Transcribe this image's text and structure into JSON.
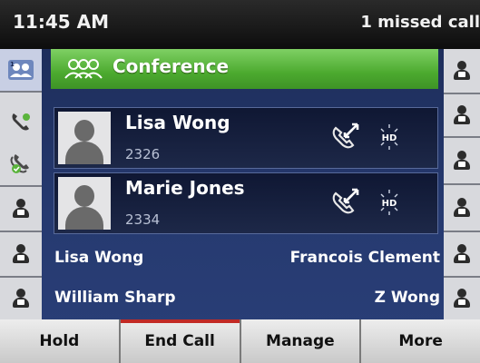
{
  "status": {
    "time": "11:45 AM",
    "missed_calls": "1 missed call"
  },
  "conference": {
    "title": "Conference"
  },
  "calls": [
    {
      "name": "Lisa Wong",
      "number": "2326",
      "hd_label": "HD"
    },
    {
      "name": "Marie Jones",
      "number": "2334",
      "hd_label": "HD"
    }
  ],
  "favorites": [
    {
      "left": "Lisa Wong",
      "right": "Francois Clement"
    },
    {
      "left": "William Sharp",
      "right": "Z Wong"
    }
  ],
  "softkeys": [
    "Hold",
    "End Call",
    "Manage",
    "More"
  ],
  "icons": {
    "conference_line": "conference-icon",
    "call_line": "phone-handset-icon",
    "contact": "contact-icon",
    "transfer": "call-transfer-icon",
    "hd": "hd-audio-icon"
  },
  "colors": {
    "accent_green": "#4caa2f",
    "end_call_accent": "#c22a25",
    "screen_blue": "#263a70"
  }
}
